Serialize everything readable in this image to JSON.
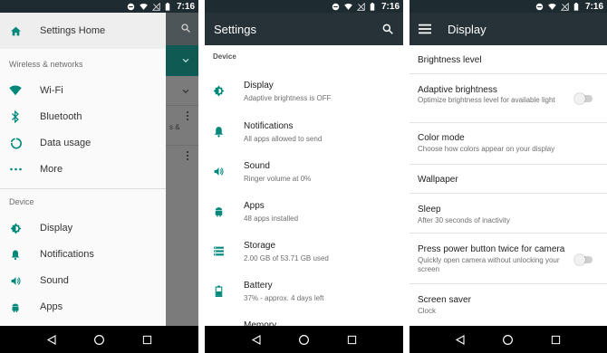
{
  "status_bar": {
    "time": "7:16"
  },
  "drawer": {
    "home": "Settings Home",
    "section_wireless": "Wireless & networks",
    "wireless_items": [
      {
        "label": "Wi-Fi",
        "icon": "wifi-icon"
      },
      {
        "label": "Bluetooth",
        "icon": "bluetooth-icon"
      },
      {
        "label": "Data usage",
        "icon": "data-usage-icon"
      },
      {
        "label": "More",
        "icon": "more-icon"
      }
    ],
    "section_device": "Device",
    "device_items": [
      {
        "label": "Display",
        "icon": "brightness-icon"
      },
      {
        "label": "Notifications",
        "icon": "bell-icon"
      },
      {
        "label": "Sound",
        "icon": "volume-icon"
      },
      {
        "label": "Apps",
        "icon": "android-icon"
      }
    ]
  },
  "background_fragment": {
    "text": "s &"
  },
  "settings": {
    "title": "Settings",
    "category": "Device",
    "items": [
      {
        "title": "Display",
        "subtitle": "Adaptive brightness is OFF",
        "icon": "brightness-icon"
      },
      {
        "title": "Notifications",
        "subtitle": "All apps allowed to send",
        "icon": "bell-icon"
      },
      {
        "title": "Sound",
        "subtitle": "Ringer volume at 0%",
        "icon": "volume-icon"
      },
      {
        "title": "Apps",
        "subtitle": "48 apps installed",
        "icon": "android-icon"
      },
      {
        "title": "Storage",
        "subtitle": "2.00 GB of 53.71 GB used",
        "icon": "storage-icon"
      },
      {
        "title": "Battery",
        "subtitle": "37% - approx. 4 days left",
        "icon": "battery-icon"
      },
      {
        "title": "Memory",
        "subtitle": "",
        "icon": "memory-icon"
      }
    ]
  },
  "display": {
    "title": "Display",
    "items": [
      {
        "title": "Brightness level",
        "subtitle": ""
      },
      {
        "title": "Adaptive brightness",
        "subtitle": "Optimize brightness level for available light",
        "toggle": false
      },
      {
        "title": "Color mode",
        "subtitle": "Choose how colors appear on your display"
      },
      {
        "title": "Wallpaper",
        "subtitle": ""
      },
      {
        "title": "Sleep",
        "subtitle": "After 30 seconds of inactivity"
      },
      {
        "title": "Press power button twice for camera",
        "subtitle": "Quickly open camera without unlocking your screen",
        "toggle": false
      },
      {
        "title": "Screen saver",
        "subtitle": "Clock"
      }
    ]
  },
  "colors": {
    "accent": "#009688",
    "appbar": "#263238",
    "statusbar": "#1e2b30"
  }
}
